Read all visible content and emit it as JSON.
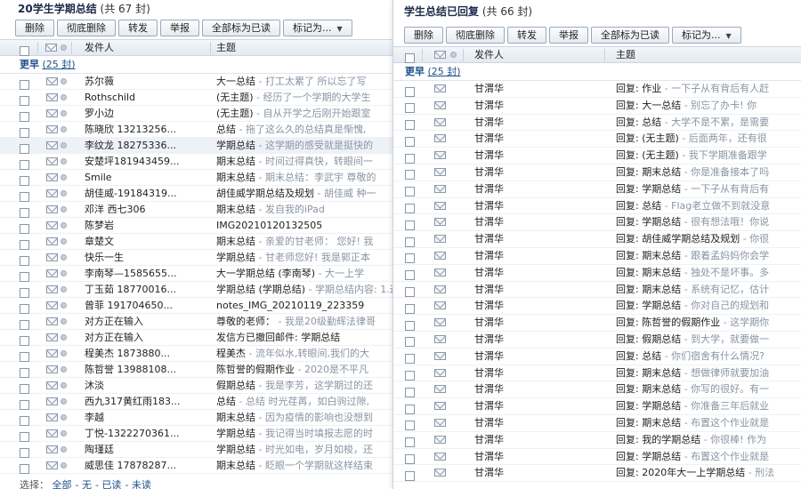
{
  "left": {
    "title": "20学生学期总结",
    "count": "(共 67 封)",
    "toolbar": [
      "删除",
      "彻底删除",
      "转发",
      "举报",
      "全部标为已读",
      "标记为..."
    ],
    "columns": {
      "sender": "发件人",
      "subject": "主题"
    },
    "group": {
      "label": "更早",
      "count": "(25 封)"
    },
    "rows": [
      {
        "sender": "苏尔薇",
        "subject": "大一总结",
        "preview": " - 打工太累了 所以忘了写"
      },
      {
        "sender": "Rothschild",
        "subject": "(无主题)",
        "preview": " - 经历了一个学期的大学生"
      },
      {
        "sender": "罗小边",
        "subject": "(无主题)",
        "preview": " - 自从开学之后刚开始跟室"
      },
      {
        "sender": "陈晓欣 13213256...",
        "subject": "总结",
        "preview": " - 拖了这么久的总结真是惭愧,"
      },
      {
        "sender": "李纹龙 18275336...",
        "subject": "学期总结",
        "preview": " - 这学期的感受就是挺快的"
      },
      {
        "sender": "安楚坪181943459...",
        "subject": "期末总结",
        "preview": " - 时间过得真快，转眼间一"
      },
      {
        "sender": "Smile",
        "subject": "期末总结",
        "preview": " - 期末总结：李武宇 尊敬的"
      },
      {
        "sender": "胡佳威-19184319...",
        "subject": "胡佳威学期总结及规划",
        "preview": " - 胡佳威 种一"
      },
      {
        "sender": "邓洋 西七306",
        "subject": "期末总结",
        "preview": " - 发自我的iPad"
      },
      {
        "sender": "陈梦岩",
        "subject": "IMG20210120132505",
        "preview": ""
      },
      {
        "sender": "章楚文",
        "subject": "期末总结",
        "preview": " - 亲爱的甘老师： 您好! 我"
      },
      {
        "sender": "快乐一生",
        "subject": "学期总结",
        "preview": " - 甘老师您好! 我是郭正本"
      },
      {
        "sender": "李南琴—1585655...",
        "subject": "大一学期总结 (李南琴)",
        "preview": " - 大一上学"
      },
      {
        "sender": "丁玉茹 18770016...",
        "subject": "学期总结 (学期总结)",
        "preview": " - 学期总结内容: 1.这学期"
      },
      {
        "sender": "曾菲 191704650...",
        "subject": "notes_IMG_20210119_223359",
        "preview": ""
      },
      {
        "sender": "对方正在输入",
        "subject": "尊敬的老师：",
        "preview": " - 我是20级勤辉法律哥"
      },
      {
        "sender": "对方正在输入",
        "subject": "发信方已撤回邮件: 学期总结",
        "preview": ""
      },
      {
        "sender": "程美杰  1873880...",
        "subject": "程美杰",
        "preview": " - 流年似水,转眼间,我们的大"
      },
      {
        "sender": "陈哲誉 13988108...",
        "subject": "陈哲誉的假期作业",
        "preview": " - 2020是不平凡"
      },
      {
        "sender": "沐淡",
        "subject": "假期总结",
        "preview": " - 我是李芳，这学期过的还"
      },
      {
        "sender": "西九317黄红雨183...",
        "subject": "总结",
        "preview": " - 总结 时光荏苒，如白驹过隙,"
      },
      {
        "sender": "李越",
        "subject": "期末总结",
        "preview": " - 因为疫情的影响也没想到"
      },
      {
        "sender": "丁悦-1322270361...",
        "subject": "学期总结",
        "preview": " - 我记得当时填报志愿的时"
      },
      {
        "sender": "陶瑾廷",
        "subject": "学期总结",
        "preview": " - 时光如电，岁月如梭，还"
      },
      {
        "sender": "威思佳  17878287...",
        "subject": "期末总结",
        "preview": " - 眨眼一个学期就这样结束"
      }
    ],
    "bottom": {
      "label": "选择：",
      "links": [
        "全部",
        "无",
        "已读",
        "未读"
      ]
    }
  },
  "right": {
    "title": "学生总结已回复",
    "count": "(共 66 封)",
    "toolbar": [
      "删除",
      "彻底删除",
      "转发",
      "举报",
      "全部标为已读",
      "标记为..."
    ],
    "columns": {
      "sender": "发件人",
      "subject": "主题"
    },
    "group": {
      "label": "更早",
      "count": "(25 封)"
    },
    "rows": [
      {
        "sender": "甘渭华",
        "subject": "回复: 作业",
        "preview": " - 一下子从有背后有人赶"
      },
      {
        "sender": "甘渭华",
        "subject": "回复: 大一总结",
        "preview": " - 别忘了办卡! 你"
      },
      {
        "sender": "甘渭华",
        "subject": "回复: 总结",
        "preview": " - 大学不是不累，是需要"
      },
      {
        "sender": "甘渭华",
        "subject": "回复: (无主题)",
        "preview": " - 后面两年，还有很"
      },
      {
        "sender": "甘渭华",
        "subject": "回复: (无主题)",
        "preview": " - 我下学期准备跟学"
      },
      {
        "sender": "甘渭华",
        "subject": "回复: 期末总结",
        "preview": " - 你是准备接本了吗"
      },
      {
        "sender": "甘渭华",
        "subject": "回复: 学期总结",
        "preview": " - 一下子从有背后有"
      },
      {
        "sender": "甘渭华",
        "subject": "回复: 总结",
        "preview": " - Flag老立做不到就没意"
      },
      {
        "sender": "甘渭华",
        "subject": "回复: 学期总结",
        "preview": " - 很有想法哦！你说"
      },
      {
        "sender": "甘渭华",
        "subject": "回复: 胡佳威学期总结及规划",
        "preview": " - 你很"
      },
      {
        "sender": "甘渭华",
        "subject": "回复: 期末总结",
        "preview": " - 跟着孟妈妈你会学"
      },
      {
        "sender": "甘渭华",
        "subject": "回复: 期末总结",
        "preview": " - 独处不是坏事。多"
      },
      {
        "sender": "甘渭华",
        "subject": "回复: 期末总结",
        "preview": " - 系统有记忆，估计"
      },
      {
        "sender": "甘渭华",
        "subject": "回复: 学期总结",
        "preview": " - 你对自己的规划和"
      },
      {
        "sender": "甘渭华",
        "subject": "回复: 陈哲誉的假期作业",
        "preview": " - 这学期你"
      },
      {
        "sender": "甘渭华",
        "subject": "回复: 假期总结",
        "preview": " - 到大学，就要做一"
      },
      {
        "sender": "甘渭华",
        "subject": "回复: 总结",
        "preview": " - 你们宿舍有什么情况?"
      },
      {
        "sender": "甘渭华",
        "subject": "回复: 期末总结",
        "preview": " - 想做律师就要加油"
      },
      {
        "sender": "甘渭华",
        "subject": "回复: 期末总结",
        "preview": " - 你写的很好。有一"
      },
      {
        "sender": "甘渭华",
        "subject": "回复: 学期总结",
        "preview": " - 你准备三年后就业"
      },
      {
        "sender": "甘渭华",
        "subject": "回复: 期末总结",
        "preview": " - 布置这个作业就是"
      },
      {
        "sender": "甘渭华",
        "subject": "回复: 我的学期总结",
        "preview": " - 你很棒! 作为"
      },
      {
        "sender": "甘渭华",
        "subject": "回复: 学期总结",
        "preview": " - 布置这个作业就是"
      },
      {
        "sender": "甘渭华",
        "subject": "回复: 2020年大一上学期总结",
        "preview": " - 刑法"
      }
    ]
  }
}
